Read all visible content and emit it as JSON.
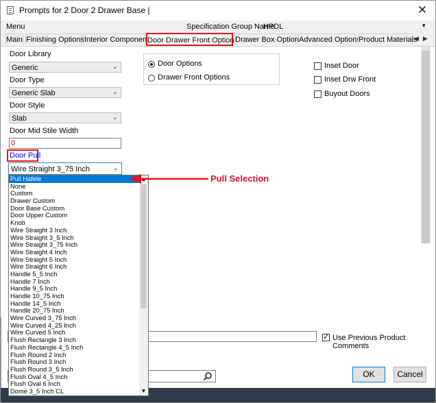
{
  "window": {
    "title": "Prompts for 2 Door 2 Drawer Base |",
    "close_glyph": "✕"
  },
  "menubar": {
    "menu": "Menu",
    "spec_group_label": "Specification Group Name",
    "spec_group_value": "HPDL"
  },
  "tabs": [
    {
      "label": "Main"
    },
    {
      "label": "Finishing Options"
    },
    {
      "label": "Interior Components"
    },
    {
      "label": "Door Drawer Front Options"
    },
    {
      "label": "Drawer Box Options"
    },
    {
      "label": "Advanced Options"
    },
    {
      "label": "Product Materials"
    }
  ],
  "active_tab": "Door Drawer Front Options",
  "left_panel": {
    "door_library_label": "Door Library",
    "door_library_value": "Generic",
    "door_type_label": "Door Type",
    "door_type_value": "Generic Slab",
    "door_style_label": "Door Style",
    "door_style_value": "Slab",
    "mid_stile_label": "Door Mid Stile Width",
    "mid_stile_value": "0",
    "door_pull_label": "Door Pull",
    "door_pull_value": "Wire Straight 3_75 Inch"
  },
  "options_group": {
    "door_options": "Door Options",
    "drawer_front_options": "Drawer Front Options",
    "selected": "Door Options"
  },
  "checkboxes": [
    {
      "label": "Inset Door",
      "checked": false
    },
    {
      "label": "Inset Drw Front",
      "checked": false
    },
    {
      "label": "Buyout Doors",
      "checked": false
    }
  ],
  "pull_dropdown": {
    "items": [
      "Pull Hafele",
      "None",
      "Custom",
      "Drawer Custom",
      "Door Base Custom",
      "Door Upper Custom",
      "Knob",
      "Wire Straight 3 Inch",
      "Wire Straight 3_5 Inch",
      "Wire Straight 3_75 Inch",
      "Wire Straight 4 Inch",
      "Wire Straight 5 Inch",
      "Wire Straight 6 Inch",
      "Handle 5_5 Inch",
      "Handle 7 Inch",
      "Handle 9_5 Inch",
      "Handle 10_75 Inch",
      "Handle 14_5 Inch",
      "Handle 20_75 Inch",
      "Wire Curved 3_75 Inch",
      "Wire Curved 4_25 Inch",
      "Wire Curved 5 Inch",
      "Flush Rectangle 3 Inch",
      "Flush Rectangle 4_5 Inch",
      "Flush Round 2 Inch",
      "Flush Round 3 Inch",
      "Flush Round 3_5 Inch",
      "Flush Oval 4_5 Inch",
      "Flush Oval 6 Inch",
      "Dome 3_5 Inch CL"
    ],
    "highlighted": "Pull Hafele"
  },
  "bottom": {
    "use_previous_comments": "Use Previous Product Comments",
    "use_previous_checked": true,
    "ok": "OK",
    "cancel": "Cancel"
  },
  "annotation": {
    "text": "Pull Selection",
    "color": "#e8121a"
  },
  "colors": {
    "highlight": "#e8121a",
    "selection": "#0078d7",
    "link_label": "#0000ff",
    "value_red": "#d00000"
  }
}
